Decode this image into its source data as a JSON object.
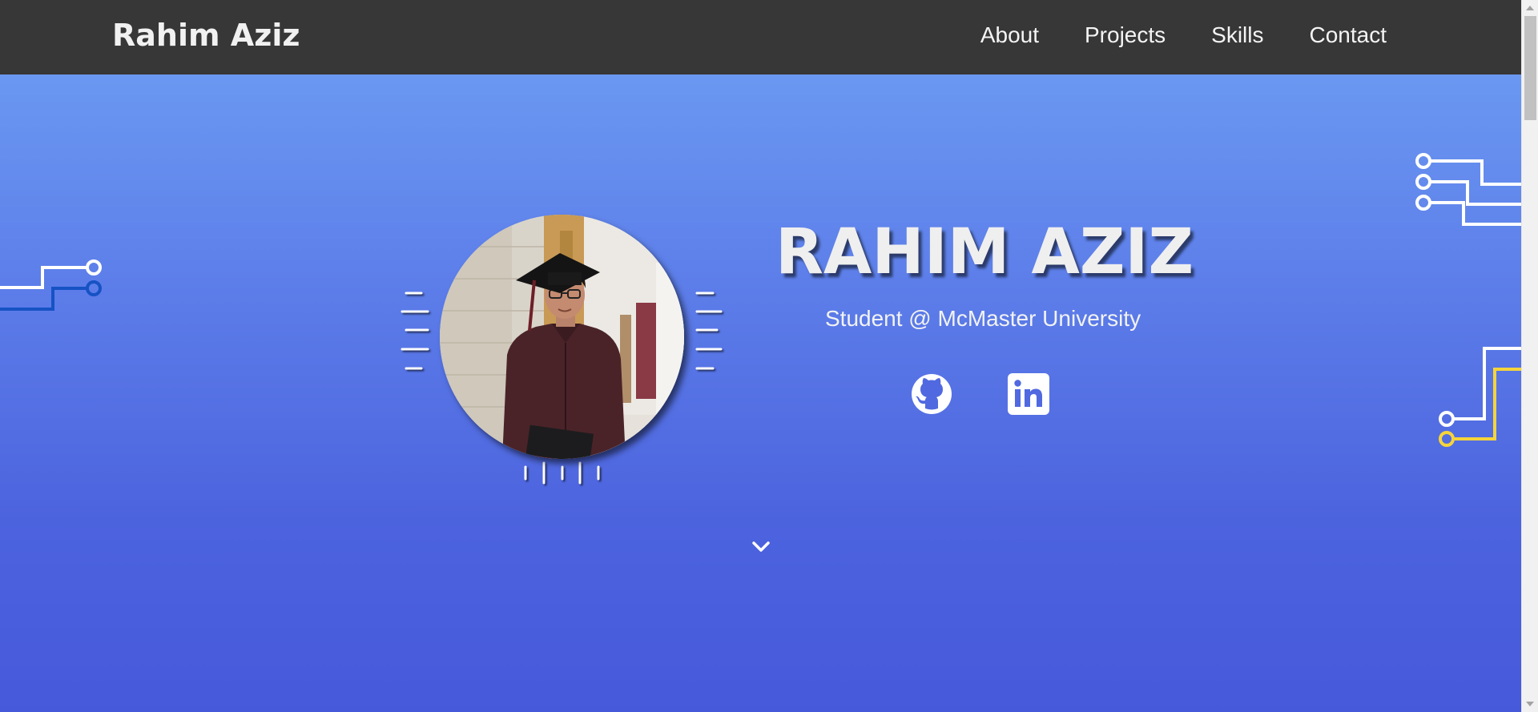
{
  "nav": {
    "brand": "Rahim Aziz",
    "links": [
      "About",
      "Projects",
      "Skills",
      "Contact"
    ]
  },
  "hero": {
    "name": "RAHIM AZIZ",
    "subtitle": "Student @ McMaster University"
  },
  "icons": {
    "github": "github-icon",
    "linkedin": "linkedin-icon",
    "scroll_down": "chevron-down-icon"
  },
  "colors": {
    "navbar": "#373737",
    "hero_top": "#6a98f1",
    "hero_bottom": "#4659db",
    "circuit_blue": "#1652c4",
    "circuit_yellow": "#f5d43a",
    "circuit_white": "#ffffff"
  }
}
